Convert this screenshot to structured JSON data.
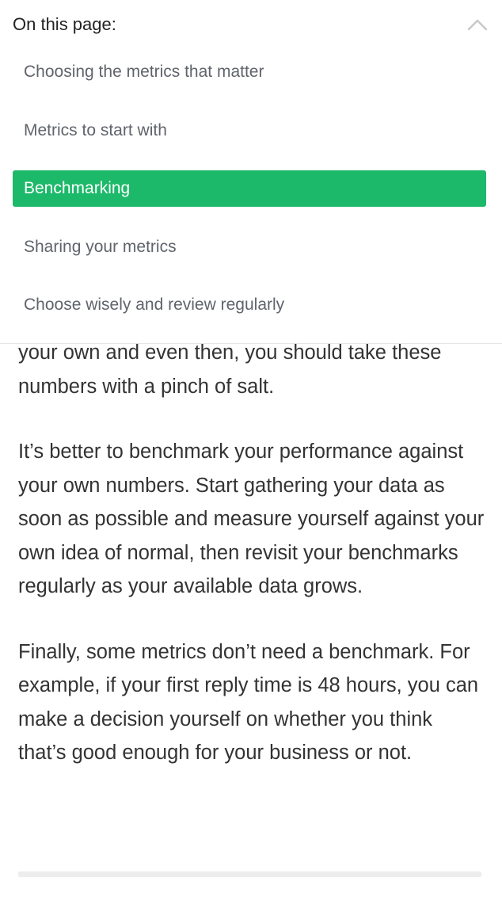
{
  "toc": {
    "title": "On this page:",
    "collapse_icon": "chevron-up-icon",
    "items": [
      {
        "label": "Choosing the metrics that matter",
        "active": false
      },
      {
        "label": "Metrics to start with",
        "active": false
      },
      {
        "label": "Benchmarking",
        "active": true
      },
      {
        "label": "Sharing your metrics",
        "active": false
      },
      {
        "label": "Choose wisely and review regularly",
        "active": false
      }
    ],
    "active_color": "#1db96a"
  },
  "article": {
    "paragraphs": [
      "your own and even then, you should take these numbers with a pinch of salt.",
      "It’s better to benchmark your performance against your own numbers. Start gathering your data as soon as possible and measure yourself against your own idea of normal, then revisit your benchmarks regularly as your available data grows.",
      "Finally, some metrics don’t need a benchmark. For example, if your first reply time is 48 hours, you can make a decision yourself on whether you think that’s good enough for your business or not."
    ]
  }
}
